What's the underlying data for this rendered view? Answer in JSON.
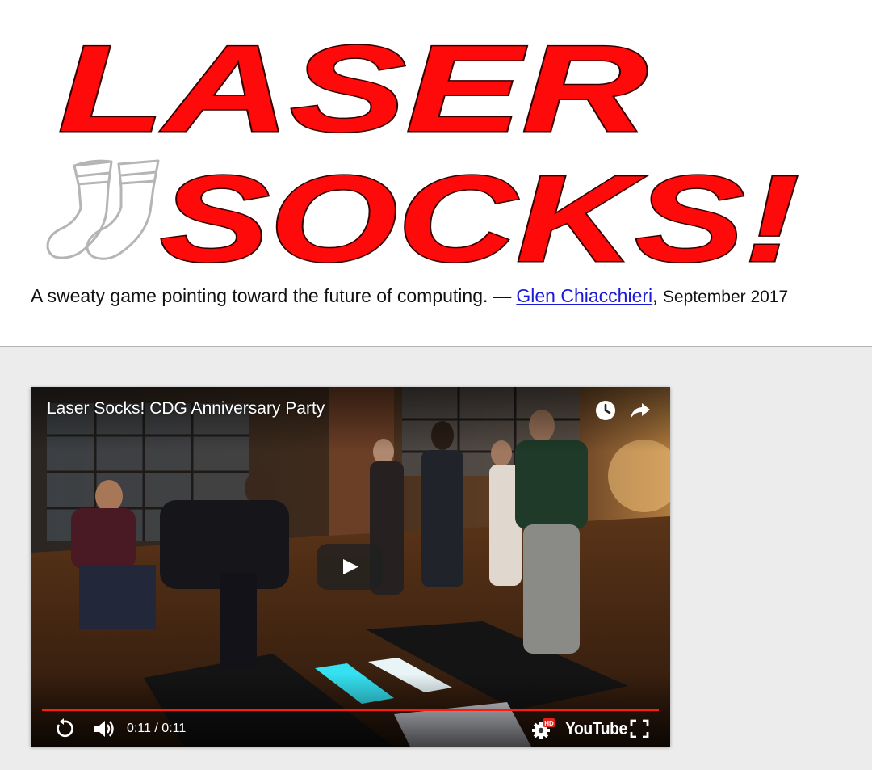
{
  "header": {
    "logo_line1": "LASER",
    "logo_line2": "SOCKS!",
    "tagline": "A sweaty game pointing toward the future of computing.",
    "dash": "—",
    "author": "Glen Chiacchieri",
    "separator": ",",
    "date": "September 2017"
  },
  "video": {
    "title": "Laser Socks! CDG Anniversary Party",
    "current_time": "0:11",
    "duration": "0:11",
    "time_separator": " / ",
    "progress": 1.0,
    "branding": "YouTube",
    "hd_badge": "HD",
    "icons": {
      "watch_later": "clock-icon",
      "share": "share-arrow-icon",
      "play": "play-icon",
      "replay": "replay-icon",
      "volume": "volume-icon",
      "settings": "gear-icon",
      "fullscreen": "fullscreen-icon"
    }
  },
  "colors": {
    "logo_red": "#ff0a0a",
    "progress_red": "#ff1a0f",
    "link_blue": "#1a1ad8",
    "page_gray": "#ececec"
  }
}
